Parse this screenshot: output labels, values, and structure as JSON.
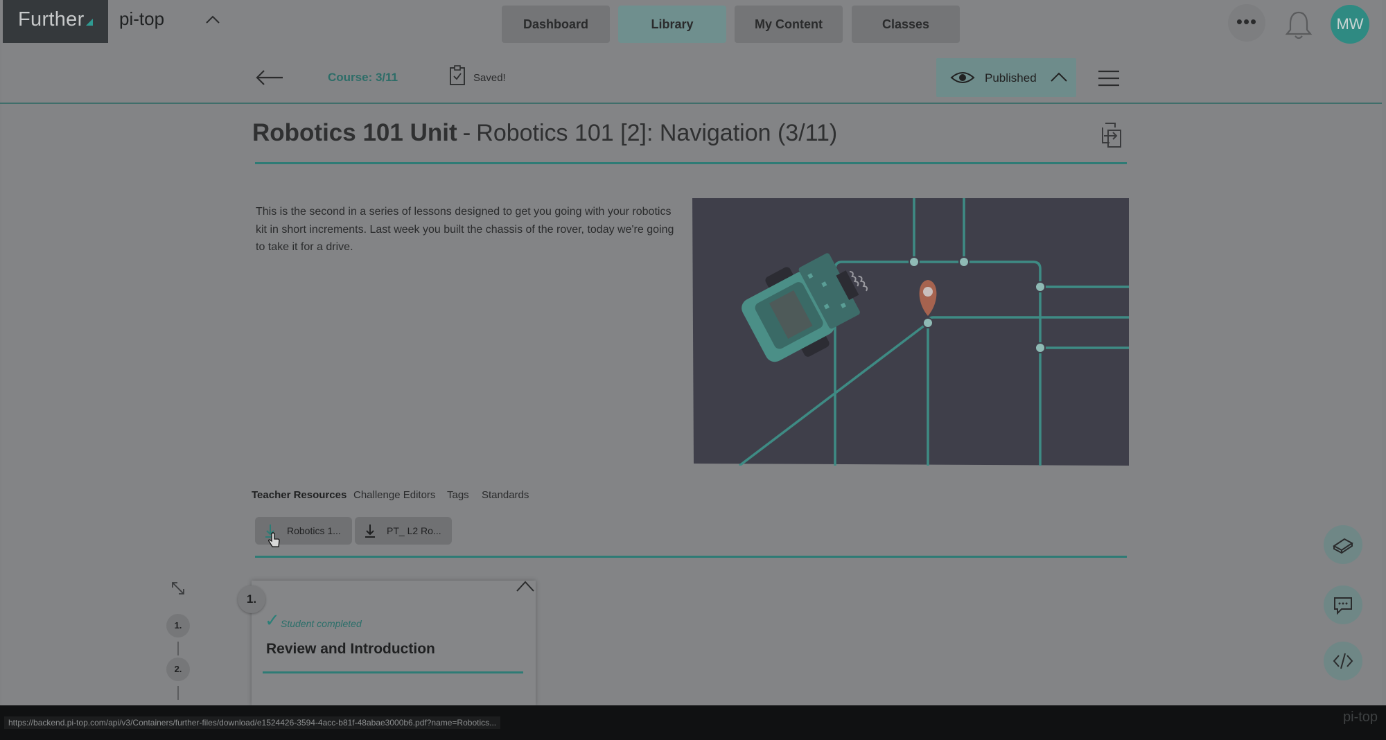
{
  "header": {
    "brand": "Further",
    "org": "pi-top",
    "nav": [
      {
        "label": "Dashboard",
        "active": false
      },
      {
        "label": "Library",
        "active": true
      },
      {
        "label": "My Content",
        "active": false
      },
      {
        "label": "Classes",
        "active": false
      }
    ],
    "more": "•••",
    "avatar_initials": "MW"
  },
  "toolbar": {
    "course_position": "Course: 3/11",
    "save_status": "Saved!",
    "publish_state": "Published"
  },
  "lesson": {
    "unit": "Robotics 101 Unit",
    "separator": "-",
    "title": "Robotics 101 [2]: Navigation (3/11)",
    "description": "This is the second in a series of lessons designed to get you going with your robotics kit in short increments. Last week you built the chassis of the rover, today we're going to take it for a drive."
  },
  "tabs": [
    "Teacher Resources",
    "Challenge Editors",
    "Tags",
    "Standards"
  ],
  "resources": [
    "Robotics 1...",
    "PT_ L2 Ro..."
  ],
  "steps": [
    "1.",
    "2."
  ],
  "section": {
    "number": "1.",
    "status": "Student completed",
    "title": "Review and Introduction"
  },
  "statusbar": {
    "url": "https://backend.pi-top.com/api/v3/Containers/further-files/download/e1524426-3594-4acc-b81f-48abae3000b6.pdf?name=Robotics...",
    "watermark": "pi-top"
  },
  "colors": {
    "accent": "#2e7b75",
    "overlay_dim": "#838486",
    "illustration_bg": "#3f3f4a"
  }
}
